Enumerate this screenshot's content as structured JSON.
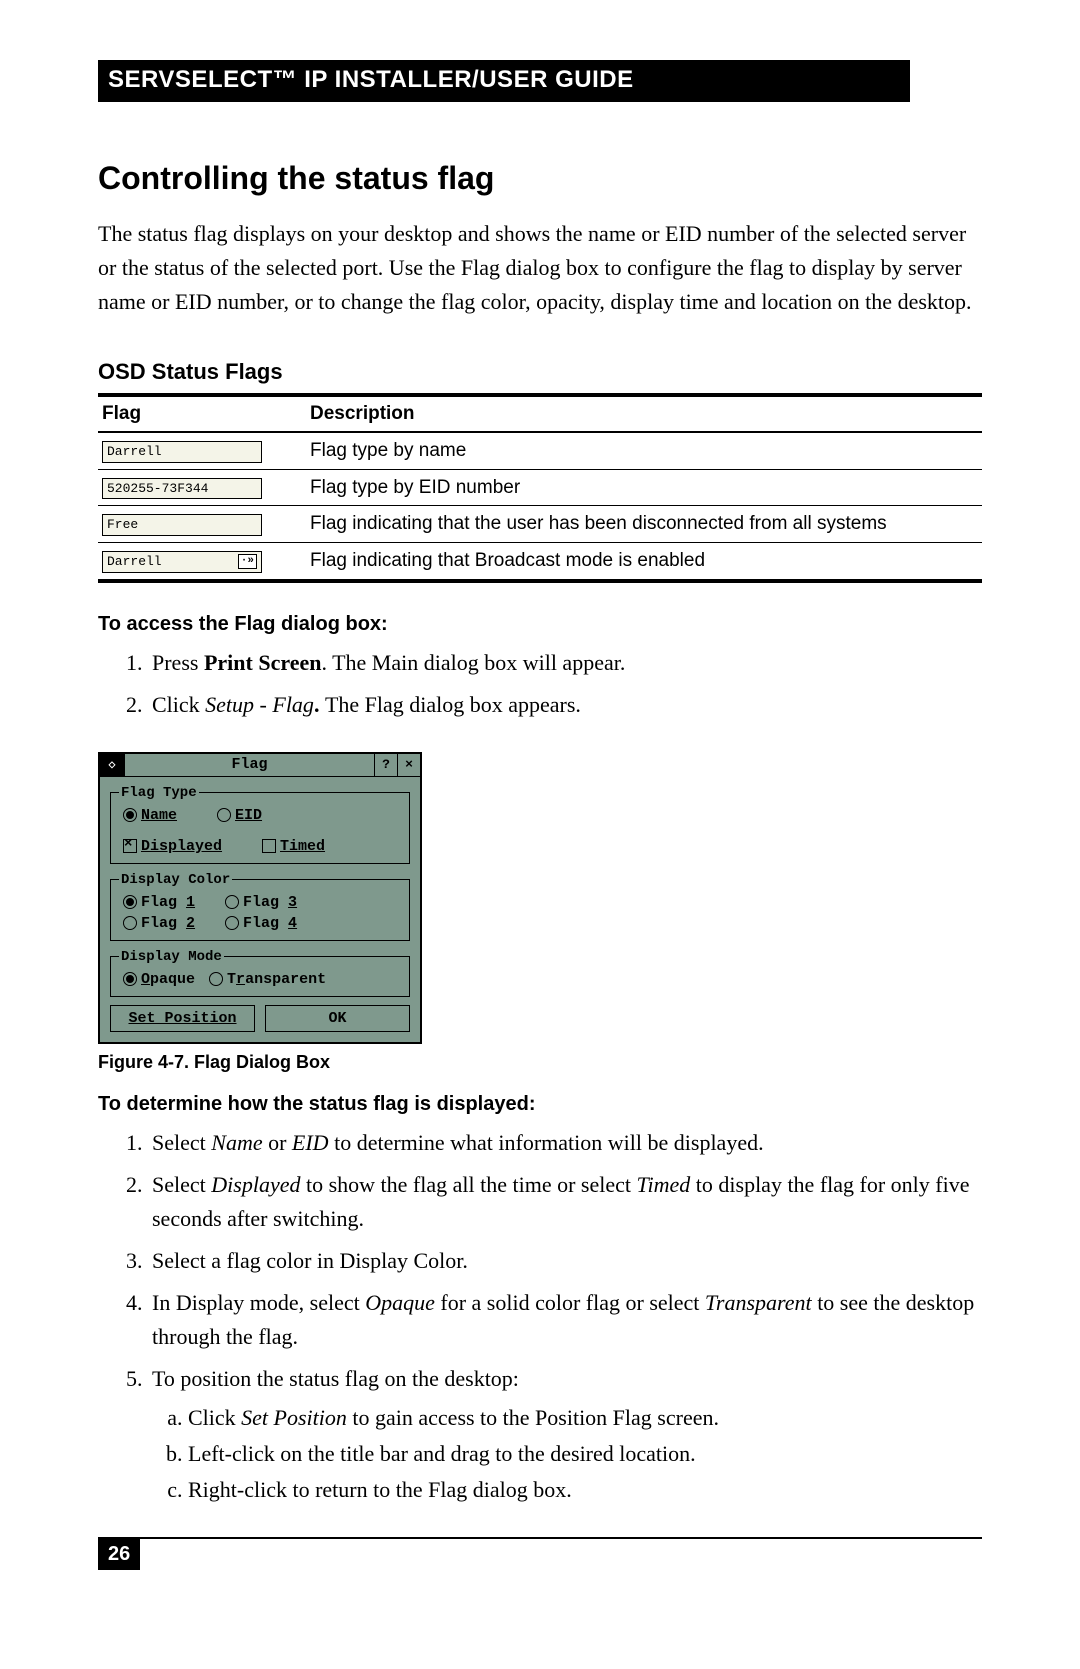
{
  "header": "SERVSELECT™ IP INSTALLER/USER GUIDE",
  "title": "Controlling the status flag",
  "intro": "The status flag displays on your desktop and shows the name or EID number of the selected server or the status of the selected port. Use the Flag dialog box to configure the flag to display by server name or EID number, or to change the flag color, opacity, display time and location on the desktop.",
  "table_title": "OSD Status Flags",
  "table": {
    "headers": [
      "Flag",
      "Description"
    ],
    "rows": [
      {
        "flag_text": "Darrell",
        "desc": "Flag type by name"
      },
      {
        "flag_text": "520255-73F344",
        "desc": "Flag type by EID number"
      },
      {
        "flag_text": "Free",
        "desc": "Flag indicating that the user has been disconnected from all systems"
      },
      {
        "flag_text": "Darrell",
        "desc": "Flag indicating that Broadcast mode is enabled",
        "broadcast": "·»"
      }
    ]
  },
  "access_heading": "To access the Flag dialog box:",
  "access_steps": {
    "s1_a": "Press ",
    "s1_b": "Print Screen",
    "s1_c": ". The Main dialog box will appear.",
    "s2_a": "Click ",
    "s2_b": "Setup - Flag",
    "s2_c": ". ",
    "s2_d": "The Flag dialog box appears."
  },
  "dialog": {
    "title": "Flag",
    "help": "?",
    "close": "×",
    "group_type": "Flag Type",
    "name": "Name",
    "eid": "EID",
    "displayed": "Displayed",
    "timed": "Timed",
    "group_color": "Display Color",
    "f1": "Flag 1",
    "f2": "Flag 2",
    "f3": "Flag 3",
    "f4": "Flag 4",
    "group_mode": "Display Mode",
    "opaque": "Opaque",
    "transparent": "Transparent",
    "setpos": "Set Position",
    "ok": "OK"
  },
  "figure_caption": "Figure 4-7. Flag Dialog Box",
  "determine_heading": "To determine how the status flag is displayed:",
  "det": {
    "s1_a": "Select ",
    "s1_b": "Name",
    "s1_c": " or ",
    "s1_d": "EID",
    "s1_e": " to determine what information will be displayed.",
    "s2_a": "Select ",
    "s2_b": "Displayed",
    "s2_c": " to show the flag all the time or select ",
    "s2_d": "Timed",
    "s2_e": " to display the flag for only five seconds after switching.",
    "s3": "Select a flag color in Display Color.",
    "s4_a": "In Display mode, select ",
    "s4_b": "Opaque",
    "s4_c": " for a solid color flag or select ",
    "s4_d": "Transparent",
    "s4_e": " to see the desktop through the flag.",
    "s5": "To position the status flag on the desktop:",
    "s5a_a": "Click ",
    "s5a_b": "Set Position",
    "s5a_c": " to gain access to the Position Flag screen.",
    "s5b": "Left-click on the title bar and drag to the desired location.",
    "s5c": "Right-click to return to the Flag dialog box."
  },
  "page_number": "26"
}
